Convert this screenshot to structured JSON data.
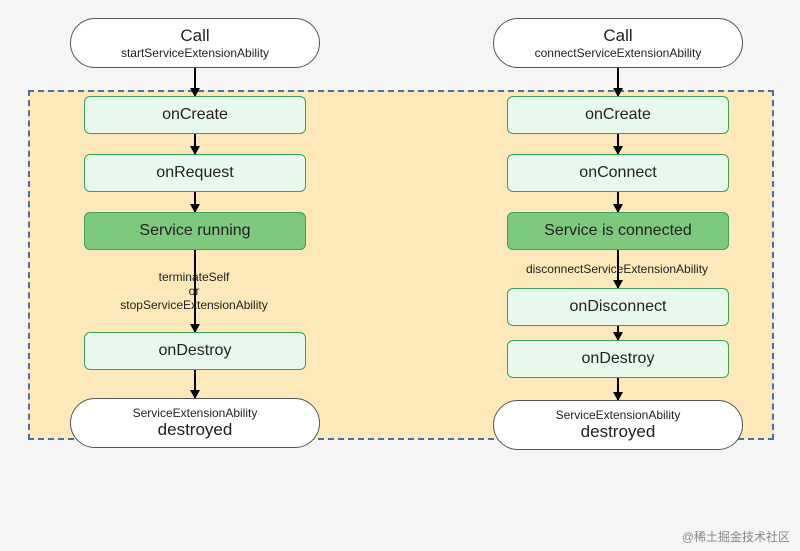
{
  "left": {
    "call_title": "Call",
    "call_sub": "startServiceExtensionAbility",
    "onCreate": "onCreate",
    "onRequest": "onRequest",
    "running": "Service running",
    "terminate_l1": "terminateSelf",
    "terminate_l2": "or",
    "terminate_l3": "stopServiceExtensionAbility",
    "onDestroy": "onDestroy",
    "destroyed_sub": "ServiceExtensionAbility",
    "destroyed": "destroyed"
  },
  "right": {
    "call_title": "Call",
    "call_sub": "connectServiceExtensionAbility",
    "onCreate": "onCreate",
    "onConnect": "onConnect",
    "connected": "Service is connected",
    "disconnect_label": "disconnectServiceExtensionAbility",
    "onDisconnect": "onDisconnect",
    "onDestroy": "onDestroy",
    "destroyed_sub": "ServiceExtensionAbility",
    "destroyed": "destroyed"
  },
  "watermark": "@稀土掘金技术社区"
}
